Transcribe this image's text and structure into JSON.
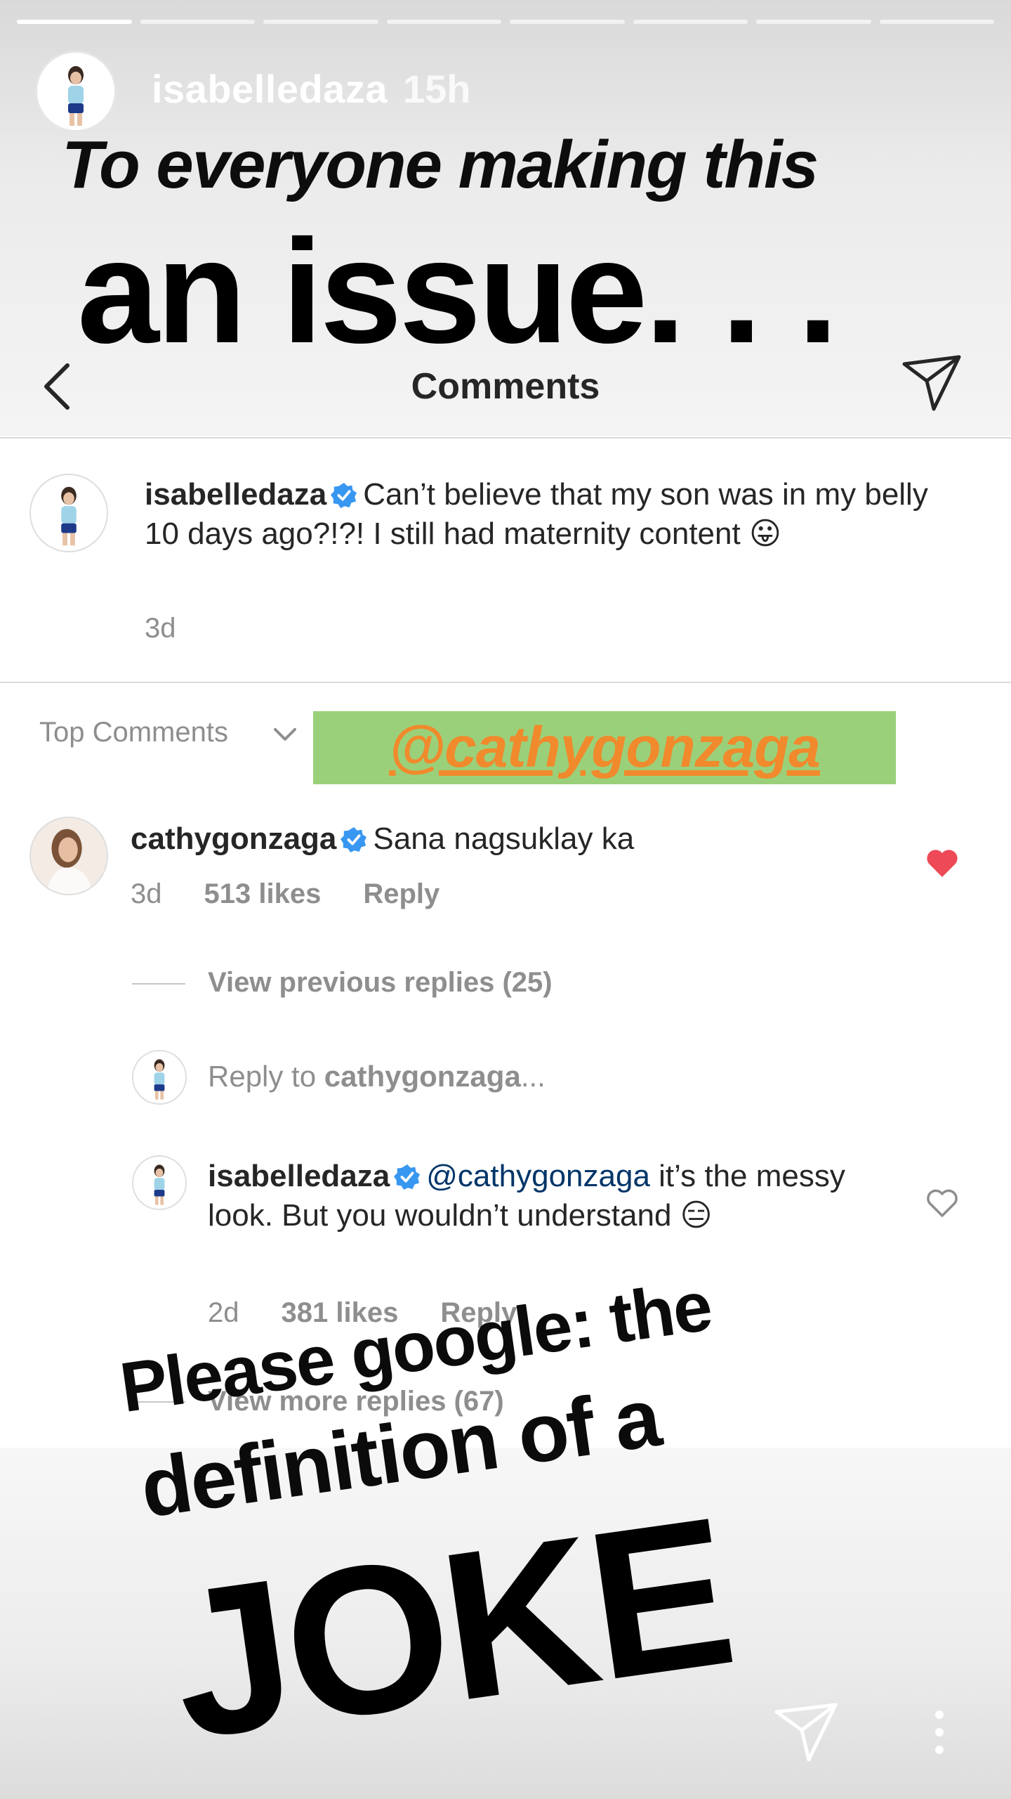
{
  "story": {
    "progress_segments": 8,
    "progress_done": 1,
    "username": "isabelledaza",
    "time": "15h",
    "headline_line1": "To everyone making this",
    "headline_line2": "an issue. . .",
    "overlay_line1": "Please google: the",
    "overlay_line2": "definition of a",
    "overlay_line3": "JOKE"
  },
  "header": {
    "title": "Comments"
  },
  "caption": {
    "username": "isabelledaza",
    "text": "Can’t believe that my son was in my belly 10 days ago?!?! I still had maternity content",
    "emoji": "😛",
    "time": "3d"
  },
  "top_comments": {
    "label": "Top Comments",
    "mention_banner": "@cathygonzaga"
  },
  "comment": {
    "username": "cathygonzaga",
    "text": "Sana nagsuklay ka",
    "time": "3d",
    "likes": "513 likes",
    "reply_label": "Reply",
    "liked": true
  },
  "view_previous": "View previous replies (25)",
  "reply_input": {
    "prefix": "Reply to ",
    "target": "cathygonzaga",
    "suffix": "..."
  },
  "reply": {
    "username": "isabelledaza",
    "mention": "@cathygonzaga",
    "text": " it’s the messy look. But you wouldn’t understand",
    "emoji": "😑",
    "time": "2d",
    "likes": "381 likes",
    "reply_label": "Reply"
  },
  "view_more": "View more replies (67)",
  "colors": {
    "verified": "#3897f0",
    "heart": "#ed4956",
    "banner_bg": "#9bd07a",
    "banner_text": "#f08a2c"
  }
}
